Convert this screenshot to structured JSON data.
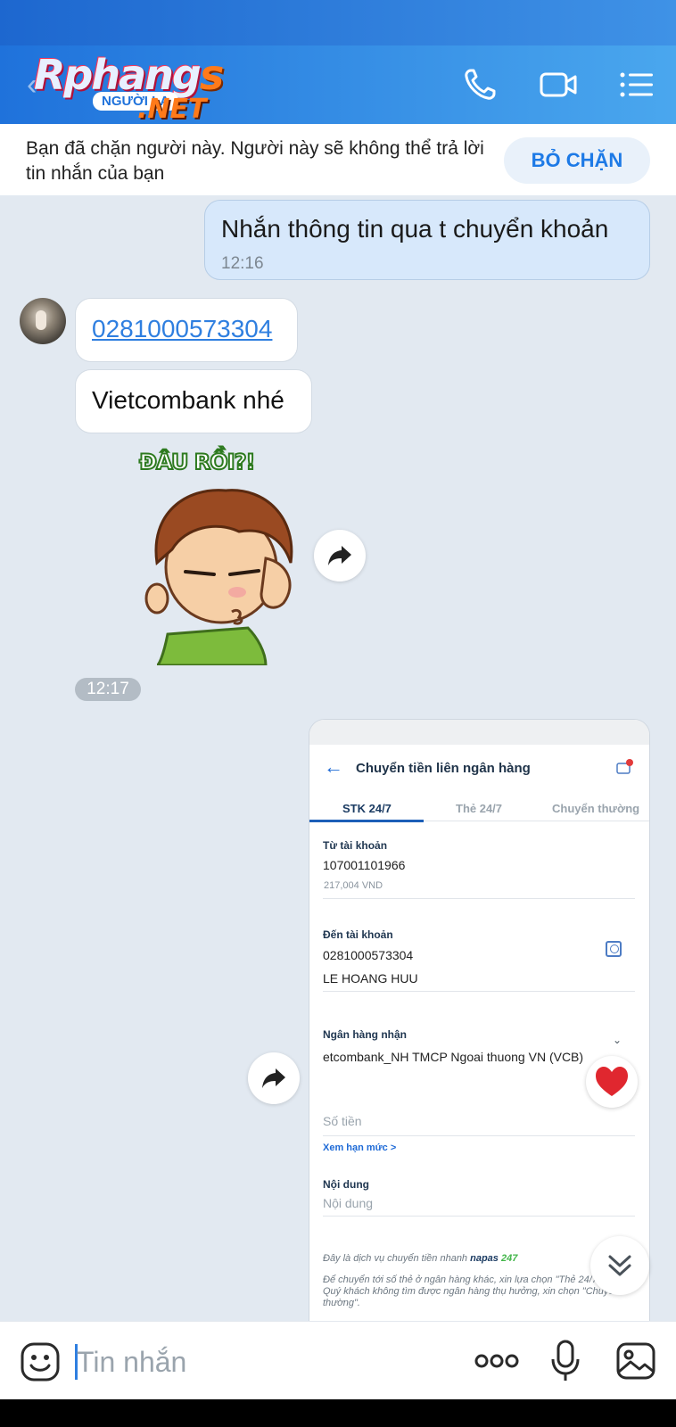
{
  "header": {
    "logo_main": "Rphang",
    "logo_main_s": "s",
    "logo_sub": "NGƯỜI LẠ",
    "logo_net": ".NET"
  },
  "block_notice": {
    "text": "Bạn đã chặn người này. Người này sẽ không thể trả lời tin nhắn của bạn",
    "button_label": "BỎ CHẶN"
  },
  "messages": {
    "outgoing_text": "Nhắn thông tin qua t chuyển khoản",
    "outgoing_time": "12:16",
    "incoming_account": "0281000573304",
    "incoming_bank": "Vietcombank nhé",
    "sticker_caption": "ĐÂU RỒI?!",
    "sticker_time": "12:17"
  },
  "transfer_screenshot": {
    "title": "Chuyển tiền liên ngân hàng",
    "tabs": [
      "STK 24/7",
      "Thẻ 24/7",
      "Chuyển thường"
    ],
    "from_label": "Từ tài khoản",
    "from_account": "107001101966",
    "from_balance": "217,004 VND",
    "to_label": "Đến tài khoản",
    "to_account": "0281000573304",
    "to_name": "LE HOANG HUU",
    "bank_label": "Ngân hàng nhận",
    "bank_value": "etcombank_NH TMCP Ngoai thuong VN (VCB)",
    "amount_placeholder": "Số tiền",
    "limit_link": "Xem hạn mức >",
    "content_label": "Nội dung",
    "content_placeholder": "Nội dung",
    "note_1": "Đây là dịch vụ chuyển tiền nhanh",
    "note_brand": "napas",
    "note_brand_247": "247",
    "note_2": "Để chuyển tới số thẻ ở ngân hàng khác, xin lựa chọn \"Thẻ 24/7\". Nếu Quý khách không tìm được ngân hàng thụ hưởng, xin chọn \"Chuyển thường\"."
  },
  "composer": {
    "placeholder": "Tin nhắn"
  },
  "colors": {
    "accent": "#2f7fe0",
    "header_start": "#1f72db",
    "header_end": "#4aa7ee",
    "outgoing_bubble": "#d7e8fb",
    "chat_background": "#e2e9f1"
  },
  "icons": [
    "back-icon",
    "phone-icon",
    "video-call-icon",
    "menu-list-icon",
    "forward-icon",
    "heart-icon",
    "double-chevron-down-icon",
    "emoji-icon",
    "more-dots-icon",
    "microphone-icon",
    "image-icon"
  ]
}
